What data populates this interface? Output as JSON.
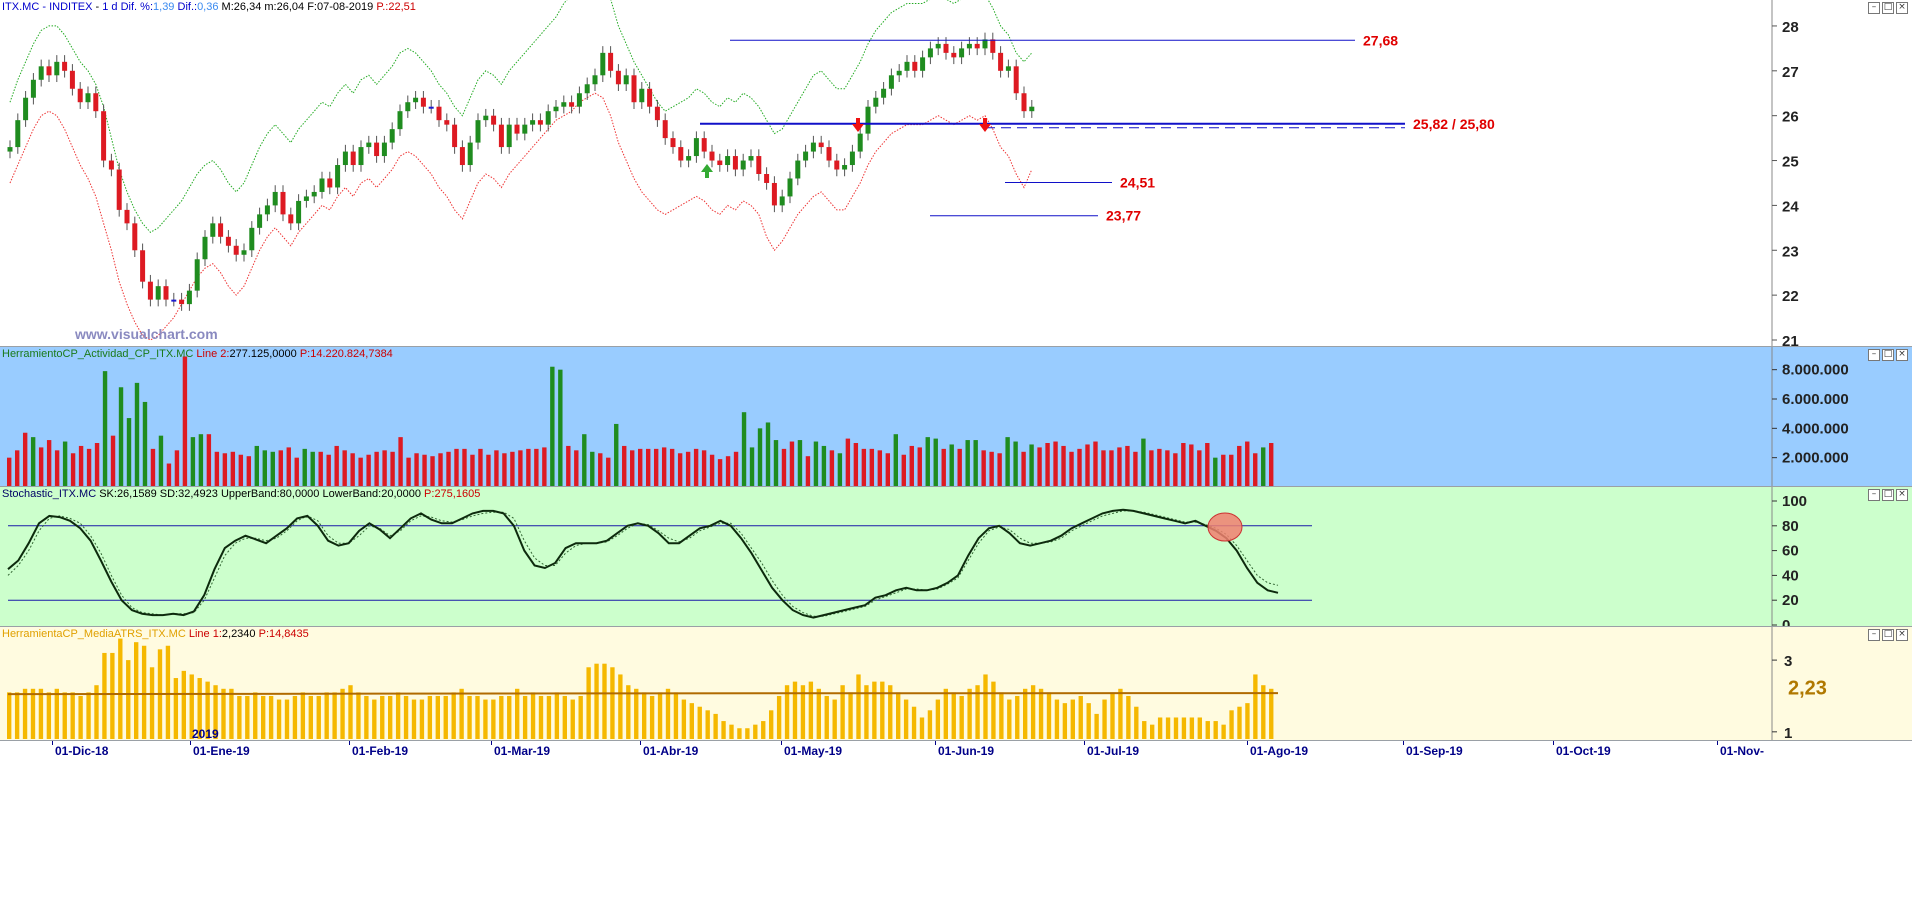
{
  "header": {
    "symbol": "ITX.MC",
    "name": "INDITEX",
    "period": "1 d",
    "dif_pct_label": "Dif. %:",
    "dif_pct": "1,39",
    "dif_label": "Dif.:",
    "dif": "0,36",
    "high_label": "M:",
    "high": "26,34",
    "low_label": "m:",
    "low": "26,04",
    "date_label": "F:",
    "date": "07-08-2019",
    "p_label": "P.:",
    "p": "22,51"
  },
  "watermark": "www.visualchart.com",
  "year_marker": "2019",
  "colors": {
    "up": "#1f8c1f",
    "down": "#dd1a22",
    "inside": "#1a1ad0",
    "level_line": "#1010c8",
    "annot": "#e00000",
    "upper_band": "#22aa22",
    "lower_band": "#ee3333",
    "vol_bg": "#99ccff",
    "stoch_bg": "#ccffcc",
    "atr_bg": "#fffbe0",
    "atr_bar": "#f5b800",
    "atr_line": "#b06a00"
  },
  "price_annotations": [
    {
      "text": "27,68",
      "value": 27.68
    },
    {
      "text": "25,82 / 25,80",
      "value": 25.82
    },
    {
      "text": "24,51",
      "value": 24.51
    },
    {
      "text": "23,77",
      "value": 23.77
    }
  ],
  "volume_header": {
    "name": "HerramientoCP_Actividad_CP_ITX.MC",
    "line_label": "Line 2:",
    "line_value": "277.125,0000",
    "p_label": "P:",
    "p_value": "14.220.824,7384"
  },
  "stoch_header": {
    "name": "Stochastic_ITX.MC",
    "sk_label": "SK:",
    "sk": "26,1589",
    "sd_label": "SD:",
    "sd": "32,4923",
    "ub_label": "UpperBand:",
    "ub": "80,0000",
    "lb_label": "LowerBand:",
    "lb": "20,0000",
    "p_label": "P:",
    "p": "275,1605"
  },
  "atr_header": {
    "name": "HerramientaCP_MediaATRS_ITX.MC",
    "line_label": "Line 1:",
    "line_value": "2,2340",
    "p_label": "P:",
    "p_value": "14,8435"
  },
  "atr_last_label": "2,23",
  "x_axis_labels": [
    "01-Dic-18",
    "01-Ene-19",
    "01-Feb-19",
    "01-Mar-19",
    "01-Abr-19",
    "01-May-19",
    "01-Jun-19",
    "01-Jul-19",
    "01-Ago-19",
    "01-Sep-19",
    "01-Oct-19",
    "01-Nov-"
  ],
  "chart_data": [
    {
      "type": "candlestick",
      "title": "ITX.MC - INDITEX - 1 d",
      "y_ticks": [
        "28",
        "27",
        "26",
        "25",
        "24",
        "23",
        "22",
        "21"
      ],
      "ylim": [
        21,
        28.2
      ],
      "closes": [
        25.3,
        25.9,
        26.4,
        26.8,
        27.1,
        26.9,
        27.2,
        27.0,
        26.6,
        26.3,
        26.5,
        26.1,
        25.0,
        24.8,
        23.9,
        23.6,
        23.0,
        22.3,
        21.9,
        22.2,
        21.9,
        21.9,
        21.8,
        22.1,
        22.8,
        23.3,
        23.6,
        23.3,
        23.1,
        22.9,
        23.0,
        23.5,
        23.8,
        24.0,
        24.3,
        23.8,
        23.6,
        24.1,
        24.2,
        24.3,
        24.6,
        24.4,
        24.9,
        25.2,
        24.9,
        25.3,
        25.4,
        25.1,
        25.4,
        25.7,
        26.1,
        26.3,
        26.4,
        26.2,
        26.2,
        25.9,
        25.8,
        25.3,
        24.9,
        25.4,
        25.9,
        26.0,
        25.8,
        25.3,
        25.8,
        25.6,
        25.8,
        25.9,
        25.8,
        26.1,
        26.2,
        26.3,
        26.2,
        26.5,
        26.7,
        26.9,
        27.4,
        27.0,
        26.7,
        26.9,
        26.3,
        26.6,
        26.2,
        25.9,
        25.5,
        25.3,
        25.0,
        25.1,
        25.5,
        25.2,
        25.0,
        24.9,
        25.1,
        24.8,
        25.0,
        25.1,
        24.7,
        24.5,
        24.0,
        24.2,
        24.6,
        25.0,
        25.2,
        25.4,
        25.3,
        25.0,
        24.8,
        24.9,
        25.2,
        25.6,
        26.2,
        26.4,
        26.6,
        26.9,
        27.0,
        27.2,
        27.0,
        27.3,
        27.5,
        27.6,
        27.4,
        27.3,
        27.5,
        27.6,
        27.5,
        27.7,
        27.4,
        27.0,
        27.1,
        26.5,
        26.1,
        26.2
      ],
      "upper_band": [
        26.3,
        26.8,
        27.2,
        27.6,
        27.9,
        28.0,
        28.0,
        27.8,
        27.5,
        27.2,
        27.0,
        26.7,
        26.2,
        25.5,
        24.8,
        24.3,
        23.9,
        23.6,
        23.4,
        23.5,
        23.7,
        23.9,
        24.1,
        24.4,
        24.7,
        24.9,
        25.0,
        24.8,
        24.5,
        24.3,
        24.5,
        24.9,
        25.3,
        25.6,
        25.8,
        25.6,
        25.4,
        25.7,
        25.9,
        26.1,
        26.3,
        26.2,
        26.5,
        26.7,
        26.5,
        26.8,
        26.9,
        26.7,
        26.9,
        27.1,
        27.4,
        27.5,
        27.4,
        27.2,
        27.0,
        26.7,
        26.5,
        26.2,
        26.0,
        26.4,
        26.8,
        27.0,
        26.9,
        26.7,
        27.0,
        27.2,
        27.4,
        27.6,
        27.8,
        28.0,
        28.2,
        28.5,
        28.7,
        28.9,
        29.0,
        29.1,
        29.0,
        28.6,
        28.0,
        27.6,
        27.2,
        26.9,
        26.6,
        26.3,
        26.1,
        26.2,
        26.3,
        26.4,
        26.6,
        26.5,
        26.3,
        26.2,
        26.4,
        26.3,
        26.5,
        26.4,
        26.2,
        25.9,
        25.6,
        25.7,
        26.0,
        26.3,
        26.6,
        26.9,
        27.0,
        26.8,
        26.6,
        26.6,
        26.9,
        27.2,
        27.6,
        27.9,
        28.1,
        28.3,
        28.4,
        28.5,
        28.5,
        28.5,
        28.6,
        28.7,
        28.6,
        28.5,
        28.6,
        28.7,
        28.6,
        28.7,
        28.4,
        28.0,
        27.8,
        27.4,
        27.2,
        27.4
      ],
      "lower_band": [
        24.5,
        24.9,
        25.3,
        25.7,
        26.0,
        26.1,
        26.0,
        25.7,
        25.3,
        24.9,
        24.6,
        24.2,
        23.6,
        23.0,
        22.3,
        21.8,
        21.4,
        21.1,
        21.0,
        21.1,
        21.3,
        21.5,
        21.8,
        22.1,
        22.4,
        22.6,
        22.7,
        22.5,
        22.2,
        22.0,
        22.2,
        22.6,
        23.0,
        23.3,
        23.5,
        23.3,
        23.1,
        23.4,
        23.6,
        23.8,
        24.0,
        23.9,
        24.2,
        24.4,
        24.2,
        24.5,
        24.6,
        24.4,
        24.6,
        24.8,
        25.1,
        25.2,
        25.1,
        24.9,
        24.7,
        24.4,
        24.2,
        23.9,
        23.7,
        24.1,
        24.5,
        24.7,
        24.6,
        24.4,
        24.7,
        24.9,
        25.1,
        25.3,
        25.5,
        25.7,
        25.9,
        26.0,
        26.1,
        26.3,
        26.4,
        26.5,
        26.4,
        26.0,
        25.4,
        25.0,
        24.6,
        24.3,
        24.1,
        23.9,
        23.8,
        23.9,
        24.0,
        24.1,
        24.2,
        24.1,
        23.9,
        23.8,
        24.0,
        23.9,
        24.1,
        24.0,
        23.8,
        23.3,
        23.0,
        23.2,
        23.5,
        23.8,
        24.0,
        24.2,
        24.3,
        24.1,
        23.9,
        23.9,
        24.2,
        24.5,
        24.9,
        25.2,
        25.4,
        25.6,
        25.7,
        25.8,
        25.8,
        25.8,
        25.9,
        26.0,
        25.9,
        25.8,
        25.9,
        26.0,
        25.9,
        26.0,
        25.7,
        25.3,
        25.1,
        24.7,
        24.4,
        24.8
      ]
    },
    {
      "type": "bar",
      "title": "HerramientoCP_Actividad_CP_ITX.MC",
      "y_ticks": [
        "8.000.000",
        "6.000.000",
        "4.000.000",
        "2.000.000"
      ],
      "ylim": [
        0,
        9000000
      ],
      "values": [
        2000000,
        2500000,
        3700000,
        3400000,
        2700000,
        3200000,
        2500000,
        3100000,
        2300000,
        2800000,
        2600000,
        3000000,
        7900000,
        3500000,
        6800000,
        4700000,
        7100000,
        5800000,
        2600000,
        3500000,
        1600000,
        2500000,
        8900000,
        3400000,
        3600000,
        3600000,
        2400000,
        2300000,
        2400000,
        2200000,
        2100000,
        2800000,
        2500000,
        2400000,
        2500000,
        2700000,
        2000000,
        2600000,
        2400000,
        2400000,
        2200000,
        2800000,
        2500000,
        2300000,
        2000000,
        2200000,
        2400000,
        2500000,
        2400000,
        3400000,
        2000000,
        2300000,
        2200000,
        2100000,
        2300000,
        2400000,
        2600000,
        2600000,
        2200000,
        2600000,
        2200000,
        2500000,
        2300000,
        2400000,
        2500000,
        2600000,
        2600000,
        2700000,
        8200000,
        8000000,
        2800000,
        2500000,
        3600000,
        2400000,
        2300000,
        2000000,
        4300000,
        2800000,
        2500000,
        2600000,
        2600000,
        2600000,
        2700000,
        2600000,
        2300000,
        2400000,
        2600000,
        2500000,
        2200000,
        1900000,
        2100000,
        2400000,
        5100000,
        2700000,
        4000000,
        4400000,
        3200000,
        2600000,
        3100000,
        3200000,
        2100000,
        3100000,
        2800000,
        2500000,
        2300000,
        3300000,
        3000000,
        2600000,
        2600000,
        2500000,
        2300000,
        3600000,
        2200000,
        2800000,
        2700000,
        3400000,
        3300000,
        2600000,
        2900000,
        2600000,
        3200000,
        3200000,
        2500000,
        2400000,
        2300000,
        3400000,
        3100000,
        2400000,
        2900000,
        2700000,
        3000000,
        3100000,
        2800000,
        2400000,
        2600000,
        2900000,
        3100000,
        2500000,
        2500000,
        2700000,
        2800000,
        2400000,
        3300000,
        2500000,
        2600000,
        2500000,
        2300000,
        3000000,
        2900000,
        2500000,
        3000000,
        2000000,
        2200000,
        2200000,
        2800000,
        3100000,
        2300000,
        2700000,
        3000000
      ],
      "colors": [
        "d",
        "d",
        "d",
        "u",
        "d",
        "d",
        "d",
        "u",
        "d",
        "d",
        "d",
        "d",
        "u",
        "d",
        "u",
        "u",
        "u",
        "u",
        "d",
        "u",
        "d",
        "d",
        "d",
        "u",
        "u",
        "d",
        "d",
        "d",
        "d",
        "d",
        "d",
        "u",
        "u",
        "u",
        "d",
        "d",
        "d",
        "u",
        "u",
        "d",
        "d",
        "d",
        "d",
        "d",
        "d",
        "d",
        "d",
        "d",
        "d",
        "d",
        "d",
        "d",
        "d",
        "d",
        "d",
        "d",
        "d",
        "d",
        "d",
        "d",
        "d",
        "d",
        "d",
        "d",
        "d",
        "d",
        "d",
        "d",
        "u",
        "u",
        "d",
        "d",
        "u",
        "u",
        "d",
        "d",
        "u",
        "d",
        "d",
        "d",
        "d",
        "d",
        "d",
        "d",
        "d",
        "d",
        "d",
        "d",
        "d",
        "d",
        "d",
        "d",
        "u",
        "u",
        "u",
        "u",
        "u",
        "d",
        "d",
        "u",
        "d",
        "u",
        "u",
        "d",
        "u",
        "d",
        "d",
        "d",
        "d",
        "d",
        "d",
        "u",
        "d",
        "d",
        "d",
        "u",
        "u",
        "d",
        "u",
        "d",
        "u",
        "u",
        "d",
        "d",
        "d",
        "u",
        "u",
        "d",
        "u",
        "d",
        "d",
        "d",
        "d",
        "d",
        "d",
        "d",
        "d",
        "d",
        "d",
        "d",
        "d",
        "d",
        "u",
        "d",
        "d",
        "d",
        "d",
        "d",
        "d",
        "d",
        "d",
        "u",
        "d",
        "d",
        "d",
        "d",
        "d",
        "u",
        "d"
      ]
    },
    {
      "type": "line",
      "title": "Stochastic_ITX.MC",
      "y_ticks": [
        "100",
        "80",
        "60",
        "40",
        "20",
        "0"
      ],
      "ylim": [
        0,
        100
      ],
      "upper_band": 80,
      "lower_band": 20,
      "series": [
        {
          "name": "SK",
          "values": [
            45,
            52,
            66,
            82,
            88,
            87,
            84,
            78,
            68,
            52,
            35,
            20,
            12,
            9,
            8,
            8,
            9,
            8,
            11,
            24,
            45,
            62,
            68,
            72,
            69,
            66,
            72,
            78,
            86,
            88,
            80,
            68,
            64,
            66,
            76,
            82,
            77,
            70,
            78,
            86,
            90,
            85,
            82,
            82,
            86,
            90,
            92,
            92,
            90,
            80,
            60,
            48,
            46,
            50,
            62,
            66,
            66,
            66,
            68,
            74,
            80,
            82,
            80,
            74,
            66,
            66,
            72,
            78,
            80,
            84,
            80,
            70,
            58,
            44,
            30,
            20,
            12,
            8,
            6,
            8,
            10,
            12,
            14,
            16,
            22,
            24,
            28,
            30,
            28,
            28,
            30,
            34,
            40,
            56,
            70,
            78,
            80,
            74,
            66,
            64,
            66,
            68,
            72,
            78,
            82,
            86,
            90,
            92,
            93,
            92,
            90,
            88,
            86,
            84,
            82,
            84,
            80,
            76,
            70,
            60,
            46,
            34,
            28,
            26
          ]
        },
        {
          "name": "SD",
          "values": [
            40,
            48,
            60,
            76,
            86,
            88,
            86,
            82,
            72,
            58,
            40,
            24,
            14,
            10,
            9,
            8,
            9,
            9,
            10,
            20,
            38,
            56,
            66,
            70,
            70,
            68,
            70,
            76,
            84,
            88,
            84,
            72,
            66,
            66,
            72,
            80,
            78,
            72,
            76,
            84,
            88,
            87,
            84,
            83,
            85,
            88,
            90,
            91,
            91,
            86,
            68,
            54,
            48,
            48,
            58,
            64,
            66,
            66,
            67,
            72,
            78,
            82,
            81,
            76,
            70,
            67,
            70,
            76,
            79,
            82,
            82,
            74,
            62,
            50,
            36,
            24,
            15,
            10,
            7,
            7,
            9,
            11,
            13,
            15,
            20,
            23,
            26,
            29,
            29,
            28,
            29,
            33,
            38,
            52,
            66,
            76,
            79,
            77,
            70,
            66,
            66,
            67,
            70,
            76,
            80,
            84,
            88,
            90,
            92,
            92,
            91,
            89,
            87,
            85,
            83,
            83,
            81,
            78,
            73,
            64,
            52,
            40,
            34,
            32
          ]
        }
      ]
    },
    {
      "type": "bar",
      "title": "HerramientaCP_MediaATRS_ITX.MC",
      "y_ticks": [
        "3",
        "2,23",
        "1"
      ],
      "ylim": [
        0.8,
        3.7
      ],
      "values": [
        2.1,
        2.1,
        2.2,
        2.2,
        2.2,
        2.1,
        2.2,
        2.1,
        2.1,
        2.0,
        2.1,
        2.3,
        3.2,
        3.2,
        3.6,
        3.0,
        3.5,
        3.4,
        2.8,
        3.3,
        3.4,
        2.5,
        2.7,
        2.6,
        2.5,
        2.4,
        2.3,
        2.2,
        2.2,
        2.0,
        2.0,
        2.1,
        2.0,
        2.0,
        1.9,
        1.9,
        2.0,
        2.1,
        2.0,
        2.0,
        2.1,
        2.1,
        2.2,
        2.3,
        2.1,
        2.0,
        1.9,
        2.0,
        2.0,
        2.1,
        2.0,
        1.9,
        1.9,
        2.0,
        2.0,
        2.0,
        2.1,
        2.2,
        2.0,
        2.0,
        1.9,
        1.9,
        2.0,
        2.0,
        2.2,
        2.0,
        2.1,
        2.0,
        2.0,
        2.1,
        2.0,
        1.9,
        2.0,
        2.8,
        2.9,
        2.9,
        2.8,
        2.6,
        2.3,
        2.2,
        2.1,
        2.0,
        2.1,
        2.2,
        2.1,
        1.9,
        1.8,
        1.7,
        1.6,
        1.5,
        1.3,
        1.2,
        1.1,
        1.1,
        1.2,
        1.3,
        1.6,
        2.0,
        2.3,
        2.4,
        2.3,
        2.4,
        2.2,
        2.0,
        1.9,
        2.3,
        2.1,
        2.6,
        2.3,
        2.4,
        2.4,
        2.3,
        2.1,
        1.9,
        1.7,
        1.4,
        1.6,
        1.9,
        2.2,
        2.1,
        2.0,
        2.2,
        2.3,
        2.6,
        2.4,
        2.1,
        1.9,
        2.0,
        2.2,
        2.3,
        2.2,
        2.1,
        1.9,
        1.8,
        1.9,
        2.0,
        1.8,
        1.5,
        1.9,
        2.1,
        2.2,
        2.0,
        1.7,
        1.3,
        1.2,
        1.4,
        1.4,
        1.4,
        1.4,
        1.4,
        1.4,
        1.3,
        1.3,
        1.2,
        1.6,
        1.7,
        1.8,
        2.6,
        2.3,
        2.2
      ],
      "series": [
        {
          "name": "Line 1",
          "values": [
            2.05,
            2.23
          ]
        }
      ]
    }
  ]
}
